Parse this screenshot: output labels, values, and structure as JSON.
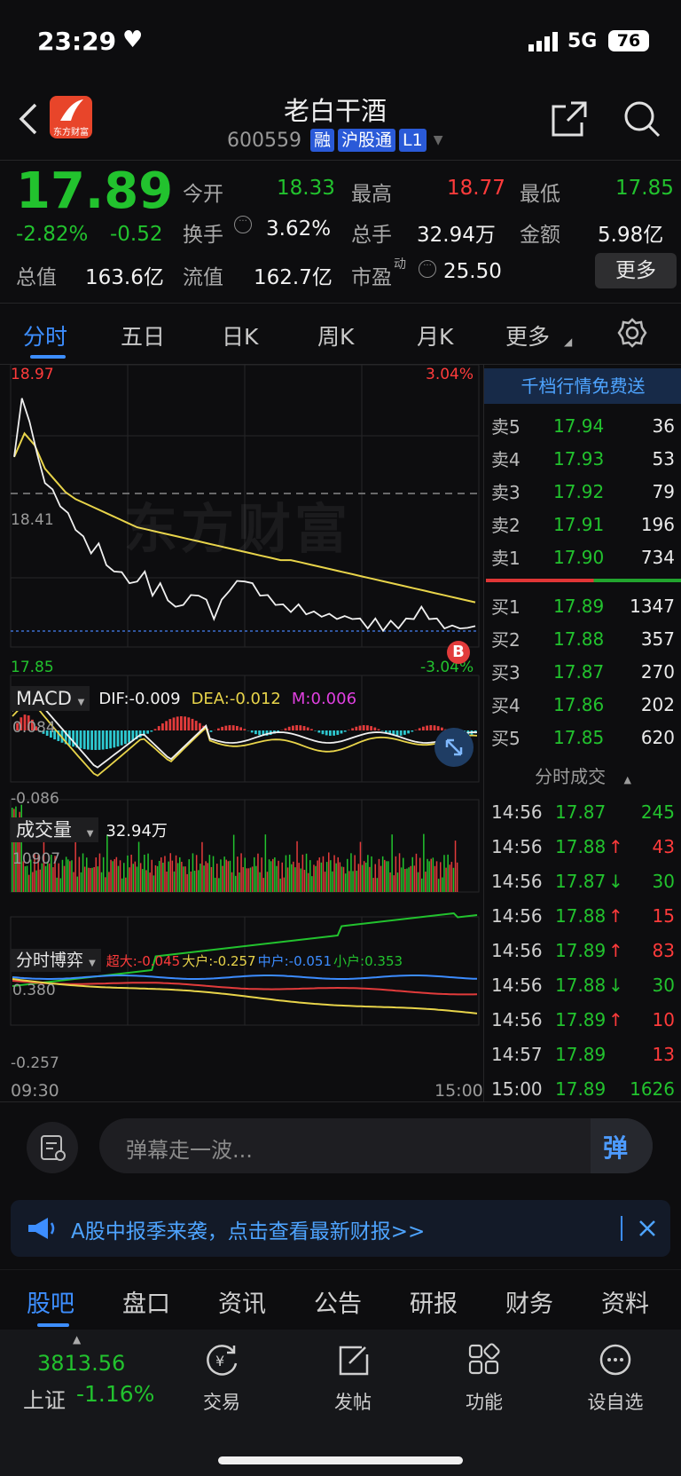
{
  "status_bar": {
    "time": "23:29",
    "network": "5G",
    "battery": "76"
  },
  "header": {
    "title": "老白干酒",
    "code": "600559",
    "tags": [
      "融",
      "沪股通",
      "L1"
    ],
    "logo_text": "东方财富"
  },
  "quote": {
    "price": "17.89",
    "change_pct": "-2.82%",
    "change_abs": "-0.52",
    "open_label": "今开",
    "open": "18.33",
    "high_label": "最高",
    "high": "18.77",
    "low_label": "最低",
    "low": "17.85",
    "turnover_label": "换手",
    "turnover": "3.62%",
    "volume_label": "总手",
    "volume": "32.94万",
    "amount_label": "金额",
    "amount": "5.98亿",
    "mcap_label": "总值",
    "mcap": "163.6亿",
    "float_label": "流值",
    "float": "162.7亿",
    "pe_label": "市盈",
    "pe_sup": "动",
    "pe": "25.50",
    "more_btn": "更多"
  },
  "tabs": [
    "分时",
    "五日",
    "日K",
    "周K",
    "月K",
    "更多"
  ],
  "chart": {
    "top_price": "18.97",
    "top_pct": "3.04%",
    "mid_price": "18.41",
    "bottom_price": "17.85",
    "bottom_pct": "-3.04%",
    "watermark": "东方财富",
    "b_marker": "B",
    "macd": {
      "label": "MACD",
      "dif": "DIF:-0.009",
      "dea": "DEA:-0.012",
      "m": "M:0.006",
      "top": "0.084",
      "bottom": "-0.086"
    },
    "volume": {
      "label": "成交量",
      "value": "32.94万",
      "top": "10907"
    },
    "game": {
      "label": "分时博弈",
      "chaoda": "超大:-0.045",
      "dahu": "大户:-0.257",
      "zhonghu": "中户:-0.051",
      "xiaohu": "小户:0.353",
      "top": "0.380",
      "bottom": "-0.257"
    },
    "start_time": "09:30",
    "end_time": "15:00"
  },
  "chart_data": {
    "type": "line",
    "price_range": [
      17.85,
      18.97
    ],
    "prev_close": 18.41,
    "price_series": [
      18.6,
      18.85,
      18.75,
      18.6,
      18.5,
      18.45,
      18.4,
      18.35,
      18.3,
      18.25,
      18.2,
      18.22,
      18.15,
      18.1,
      18.12,
      18.05,
      18.08,
      18.1,
      18.02,
      18.05,
      18.0,
      17.95,
      17.98,
      18.0,
      18.02,
      17.98,
      17.92,
      17.98,
      18.04,
      18.06,
      18.08,
      18.05,
      18.02,
      18.0,
      17.98,
      17.96,
      17.95,
      17.96,
      17.94,
      17.93,
      17.93,
      17.92,
      17.92,
      17.91,
      17.92,
      17.9,
      17.88,
      17.9,
      17.87,
      17.89,
      17.88,
      17.9,
      17.92,
      17.95,
      17.92,
      17.9,
      17.88,
      17.87,
      17.88,
      17.86,
      17.89
    ],
    "avg_series": [
      18.6,
      18.7,
      18.65,
      18.55,
      18.5,
      18.45,
      18.42,
      18.4,
      18.38,
      18.36,
      18.34,
      18.32,
      18.3,
      18.29,
      18.28,
      18.27,
      18.26,
      18.25,
      18.24,
      18.23,
      18.22,
      18.21,
      18.2,
      18.19,
      18.18,
      18.17,
      18.16,
      18.16,
      18.15,
      18.14,
      18.13,
      18.12,
      18.11,
      18.1,
      18.09,
      18.08,
      18.07,
      18.06,
      18.05,
      18.04,
      18.03,
      18.02,
      18.01,
      18.0,
      17.99,
      17.98
    ]
  },
  "order_book": {
    "banner": "千档行情免费送",
    "asks": [
      {
        "label": "卖5",
        "price": "17.94",
        "qty": "36"
      },
      {
        "label": "卖4",
        "price": "17.93",
        "qty": "53"
      },
      {
        "label": "卖3",
        "price": "17.92",
        "qty": "79"
      },
      {
        "label": "卖2",
        "price": "17.91",
        "qty": "196"
      },
      {
        "label": "卖1",
        "price": "17.90",
        "qty": "734"
      }
    ],
    "bids": [
      {
        "label": "买1",
        "price": "17.89",
        "qty": "1347"
      },
      {
        "label": "买2",
        "price": "17.88",
        "qty": "357"
      },
      {
        "label": "买3",
        "price": "17.87",
        "qty": "270"
      },
      {
        "label": "买4",
        "price": "17.86",
        "qty": "202"
      },
      {
        "label": "买5",
        "price": "17.85",
        "qty": "620"
      }
    ],
    "trades_title": "分时成交",
    "trades": [
      {
        "time": "14:56",
        "price": "17.87",
        "arrow": "",
        "qty": "245",
        "qcolor": "green"
      },
      {
        "time": "14:56",
        "price": "17.88",
        "arrow": "↑",
        "qty": "43",
        "qcolor": "red"
      },
      {
        "time": "14:56",
        "price": "17.87",
        "arrow": "↓",
        "qty": "30",
        "qcolor": "green"
      },
      {
        "time": "14:56",
        "price": "17.88",
        "arrow": "↑",
        "qty": "15",
        "qcolor": "red"
      },
      {
        "time": "14:56",
        "price": "17.89",
        "arrow": "↑",
        "qty": "83",
        "qcolor": "red"
      },
      {
        "time": "14:56",
        "price": "17.88",
        "arrow": "↓",
        "qty": "30",
        "qcolor": "green"
      },
      {
        "time": "14:56",
        "price": "17.89",
        "arrow": "↑",
        "qty": "10",
        "qcolor": "red"
      },
      {
        "time": "14:57",
        "price": "17.89",
        "arrow": "",
        "qty": "13",
        "qcolor": "red"
      },
      {
        "time": "15:00",
        "price": "17.89",
        "arrow": "",
        "qty": "1626",
        "qcolor": "green"
      }
    ]
  },
  "comment": {
    "placeholder": "弹幕走一波...",
    "send": "弹"
  },
  "notice": {
    "text": "A股中报季来袭，点击查看最新财报>>"
  },
  "bottom_tabs": [
    "股吧",
    "盘口",
    "资讯",
    "公告",
    "研报",
    "财务",
    "资料"
  ],
  "nav": {
    "index_value": "3813.56",
    "index_name": "上证",
    "index_change": "-1.16%",
    "items": [
      "交易",
      "发帖",
      "功能",
      "设自选"
    ]
  }
}
